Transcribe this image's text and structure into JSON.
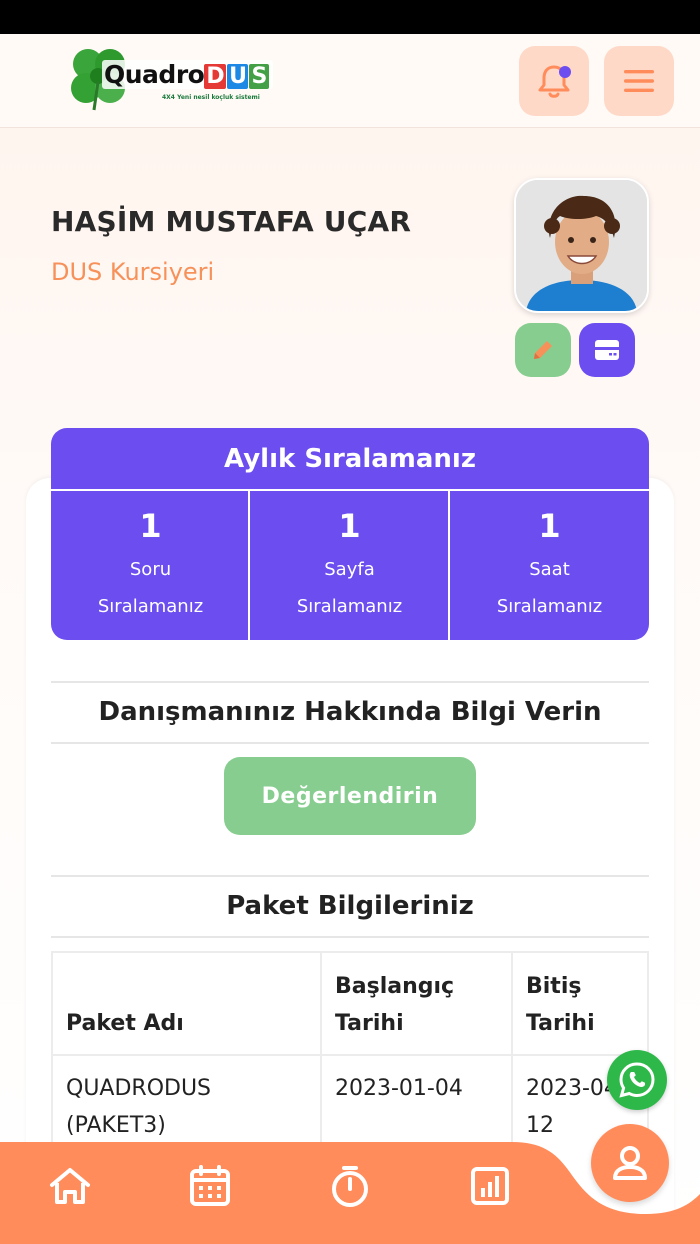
{
  "app": {
    "logo_text": "Quadro",
    "logo_dus_letters": [
      "D",
      "U",
      "S"
    ],
    "logo_dus_colors": [
      "#e53935",
      "#1e88e5",
      "#43a047"
    ],
    "logo_tagline": "4X4 Yeni nesil koçluk sistemi"
  },
  "header": {
    "notification_icon": "bell-icon",
    "notification_dot_color": "#6b4df0",
    "menu_icon": "hamburger-icon"
  },
  "profile": {
    "name": "HAŞİM MUSTAFA UÇAR",
    "role": "DUS Kursiyeri",
    "edit_icon": "pencil-icon",
    "card_icon": "card-icon"
  },
  "ranking": {
    "title": "Aylık Sıralamanız",
    "items": [
      {
        "value": "1",
        "label1": "Soru",
        "label2": "Sıralamanız"
      },
      {
        "value": "1",
        "label1": "Sayfa",
        "label2": "Sıralamanız"
      },
      {
        "value": "1",
        "label1": "Saat",
        "label2": "Sıralamanız"
      }
    ]
  },
  "advisor": {
    "title": "Danışmanınız Hakkında Bilgi Verin",
    "button_label": "Değerlendirin"
  },
  "package": {
    "title": "Paket Bilgileriniz",
    "columns": [
      "Paket Adı",
      "Başlangıç Tarihi",
      "Bitiş Tarihi"
    ],
    "rows": [
      [
        "QUADRODUS (PAKET3)",
        "2023-01-04",
        "2023-04-12"
      ]
    ]
  },
  "floating": {
    "whatsapp_icon": "whatsapp-icon"
  },
  "nav": {
    "items": [
      "home-icon",
      "calendar-icon",
      "stopwatch-icon",
      "chart-icon"
    ],
    "profile_icon": "user-icon",
    "accent": "#ff8c5a"
  }
}
